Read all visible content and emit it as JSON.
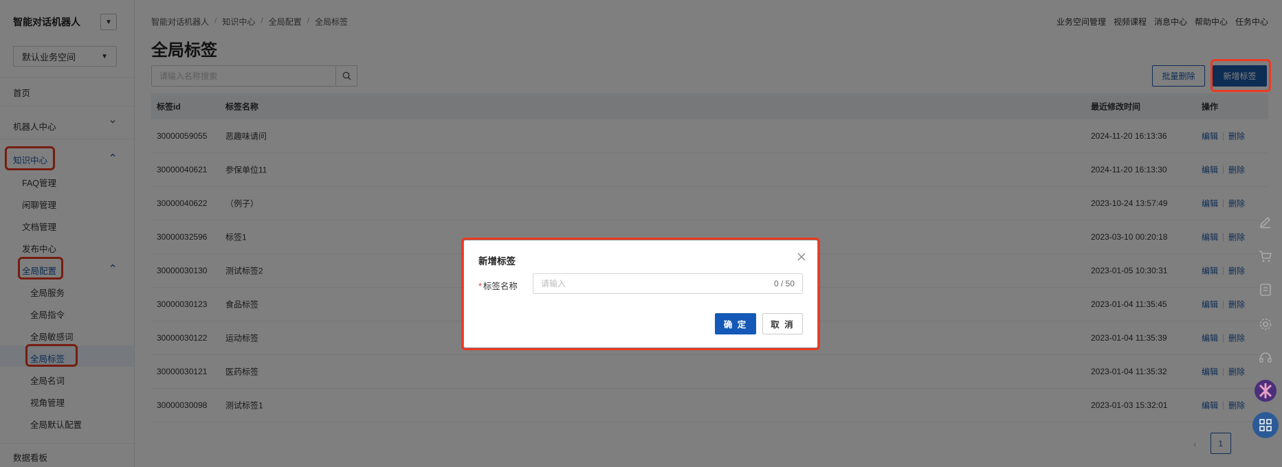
{
  "sidebar": {
    "brand": "智能对话机器人",
    "workspace": "默认业务空间",
    "items": [
      {
        "label": "首页"
      },
      {
        "label": "机器人中心"
      },
      {
        "label": "知识中心"
      },
      {
        "label": "FAQ管理"
      },
      {
        "label": "闲聊管理"
      },
      {
        "label": "文档管理"
      },
      {
        "label": "发布中心"
      },
      {
        "label": "全局配置"
      },
      {
        "label": "全局服务"
      },
      {
        "label": "全局指令"
      },
      {
        "label": "全局敏感词"
      },
      {
        "label": "全局标签"
      },
      {
        "label": "全局名词"
      },
      {
        "label": "视角管理"
      },
      {
        "label": "全局默认配置"
      },
      {
        "label": "数据看板"
      }
    ]
  },
  "header": {
    "breadcrumb": [
      "智能对话机器人",
      "知识中心",
      "全局配置",
      "全局标签"
    ],
    "top_links": [
      "业务空间管理",
      "视频课程",
      "消息中心",
      "帮助中心",
      "任务中心"
    ]
  },
  "main": {
    "title": "全局标签",
    "search_placeholder": "请输入名称搜索",
    "batch_delete": "批量删除",
    "add_tag": "新增标签"
  },
  "table": {
    "headers": [
      "标签id",
      "标签名称",
      "最近修改时间",
      "操作"
    ],
    "edit_label": "编辑",
    "delete_label": "删除",
    "rows": [
      {
        "id": "30000059055",
        "name": "恶趣味请问",
        "time": "2024-11-20 16:13:36"
      },
      {
        "id": "30000040621",
        "name": "参保单位11",
        "time": "2024-11-20 16:13:30"
      },
      {
        "id": "30000040622",
        "name": "（例子）",
        "time": "2023-10-24 13:57:49"
      },
      {
        "id": "30000032596",
        "name": "标签1",
        "time": "2023-03-10 00:20:18"
      },
      {
        "id": "30000030130",
        "name": "测试标签2",
        "time": "2023-01-05 10:30:31"
      },
      {
        "id": "30000030123",
        "name": "食品标签",
        "time": "2023-01-04 11:35:45"
      },
      {
        "id": "30000030122",
        "name": "运动标签",
        "time": "2023-01-04 11:35:39"
      },
      {
        "id": "30000030121",
        "name": "医药标签",
        "time": "2023-01-04 11:35:32"
      },
      {
        "id": "30000030098",
        "name": "测试标签1",
        "time": "2023-01-03 15:32:01"
      }
    ]
  },
  "pagination": {
    "prev": "‹",
    "current": "1"
  },
  "right_tools": [
    "edit-icon",
    "cart-icon",
    "document-icon",
    "settings-icon",
    "headset-icon",
    "app-logo-icon",
    "apps-icon"
  ],
  "dialog": {
    "title": "新增标签",
    "required_mark": "*",
    "field_label": "标签名称",
    "placeholder": "请输入",
    "count": "0 / 50",
    "confirm": "确 定",
    "cancel": "取 消"
  },
  "colors": {
    "accent": "#1c5ba8",
    "highlight": "#ea3a22",
    "required": "#e53935"
  }
}
